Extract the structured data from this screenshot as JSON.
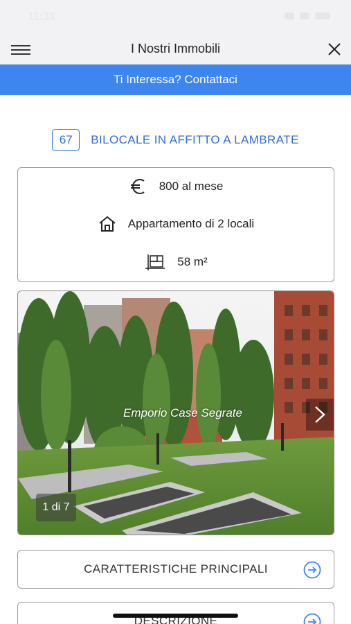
{
  "status_bar": {
    "time": "11:31"
  },
  "nav": {
    "title": "I Nostri Immobili"
  },
  "contact_banner": {
    "label": "Ti Interessa? Contattaci"
  },
  "listing": {
    "ref": "67",
    "title": "BILOCALE IN AFFITTO A LAMBRATE",
    "price": "800 al mese",
    "type": "Appartamento di 2 locali",
    "area": "58 m²"
  },
  "gallery": {
    "watermark": "Emporio Case Segrate",
    "counter": "1 di 7"
  },
  "sections": [
    {
      "label": "CARATTERISTICHE PRINCIPALI"
    },
    {
      "label": "DESCRIZIONE"
    }
  ],
  "colors": {
    "accent": "#3d86f0",
    "link": "#2f6ed6"
  }
}
